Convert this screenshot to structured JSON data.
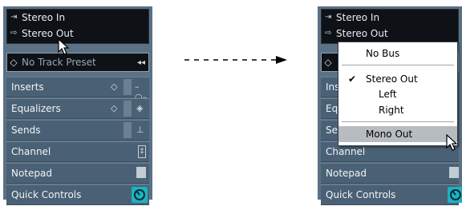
{
  "left": {
    "io": [
      {
        "icon": "input-bus-icon",
        "glyph": "→]",
        "label": "Stereo In"
      },
      {
        "icon": "output-bus-icon",
        "glyph": "[→",
        "label": "Stereo Out"
      }
    ],
    "preset": {
      "label": "No Track Preset"
    },
    "sections": [
      {
        "label": "Inserts"
      },
      {
        "label": "Equalizers"
      },
      {
        "label": "Sends"
      },
      {
        "label": "Channel"
      },
      {
        "label": "Notepad"
      },
      {
        "label": "Quick Controls"
      }
    ]
  },
  "right": {
    "io": [
      {
        "label": "Stereo In"
      },
      {
        "label": "Stereo Out"
      }
    ],
    "sections": [
      {
        "label": "Ins"
      },
      {
        "label": "Eq"
      },
      {
        "label": "Se"
      },
      {
        "label": "Channel"
      },
      {
        "label": "Notepad"
      },
      {
        "label": "Quick Controls"
      }
    ]
  },
  "menu": {
    "items": [
      {
        "label": "No Bus"
      },
      {
        "label": "Stereo Out",
        "checked": true
      },
      {
        "label": "Left"
      },
      {
        "label": "Right"
      },
      {
        "label": "Mono Out",
        "highlighted": true
      }
    ],
    "check_glyph": "✔"
  },
  "colors": {
    "panel": "#5b7185",
    "section": "#4a6175",
    "io_box": "#0e1116",
    "quick_controls_accent": "#19b3c3",
    "menu_highlight": "#b7bcc1"
  }
}
